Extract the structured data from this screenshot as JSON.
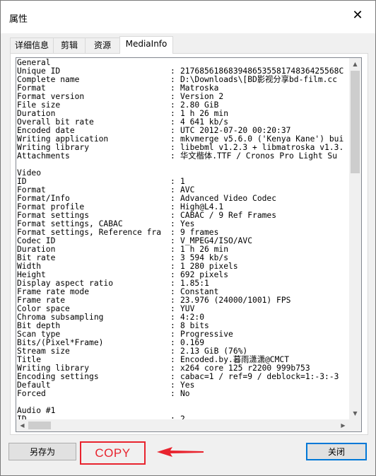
{
  "window": {
    "title": "属性",
    "close_glyph": "✕"
  },
  "tabs": [
    {
      "label": "详细信息",
      "active": false
    },
    {
      "label": "剪辑",
      "active": false
    },
    {
      "label": "资源",
      "active": false
    },
    {
      "label": "MediaInfo",
      "active": true
    }
  ],
  "mediainfo": {
    "lines": [
      {
        "label": "General",
        "value": ""
      },
      {
        "label": "Unique ID",
        "value": "217685618683948653558174836425568C"
      },
      {
        "label": "Complete name",
        "value": "D:\\Downloads\\[BD影视分享bd-film.cc"
      },
      {
        "label": "Format",
        "value": "Matroska"
      },
      {
        "label": "Format version",
        "value": "Version 2"
      },
      {
        "label": "File size",
        "value": "2.80 GiB"
      },
      {
        "label": "Duration",
        "value": "1 h 26 min"
      },
      {
        "label": "Overall bit rate",
        "value": "4 641 kb/s"
      },
      {
        "label": "Encoded date",
        "value": "UTC 2012-07-20 00:20:37"
      },
      {
        "label": "Writing application",
        "value": "mkvmerge v5.6.0 ('Kenya Kane') bui"
      },
      {
        "label": "Writing library",
        "value": "libebml v1.2.3 + libmatroska v1.3."
      },
      {
        "label": "Attachments",
        "value": "华文楷体.TTF / Cronos Pro Light Su"
      },
      {
        "label": "",
        "value": ""
      },
      {
        "label": "Video",
        "value": ""
      },
      {
        "label": "ID",
        "value": "1"
      },
      {
        "label": "Format",
        "value": "AVC"
      },
      {
        "label": "Format/Info",
        "value": "Advanced Video Codec"
      },
      {
        "label": "Format profile",
        "value": "High@L4.1"
      },
      {
        "label": "Format settings",
        "value": "CABAC / 9 Ref Frames"
      },
      {
        "label": "Format settings, CABAC",
        "value": "Yes"
      },
      {
        "label": "Format settings, Reference fra",
        "value": "9 frames"
      },
      {
        "label": "Codec ID",
        "value": "V_MPEG4/ISO/AVC"
      },
      {
        "label": "Duration",
        "value": "1 h 26 min"
      },
      {
        "label": "Bit rate",
        "value": "3 594 kb/s"
      },
      {
        "label": "Width",
        "value": "1 280 pixels"
      },
      {
        "label": "Height",
        "value": "692 pixels"
      },
      {
        "label": "Display aspect ratio",
        "value": "1.85:1"
      },
      {
        "label": "Frame rate mode",
        "value": "Constant"
      },
      {
        "label": "Frame rate",
        "value": "23.976 (24000/1001) FPS"
      },
      {
        "label": "Color space",
        "value": "YUV"
      },
      {
        "label": "Chroma subsampling",
        "value": "4:2:0"
      },
      {
        "label": "Bit depth",
        "value": "8 bits"
      },
      {
        "label": "Scan type",
        "value": "Progressive"
      },
      {
        "label": "Bits/(Pixel*Frame)",
        "value": "0.169"
      },
      {
        "label": "Stream size",
        "value": "2.13 GiB (76%)"
      },
      {
        "label": "Title",
        "value": "Encoded.by.暮雨潇潇@CMCT"
      },
      {
        "label": "Writing library",
        "value": "x264 core 125 r2200 999b753"
      },
      {
        "label": "Encoding settings",
        "value": "cabac=1 / ref=9 / deblock=1:-3:-3"
      },
      {
        "label": "Default",
        "value": "Yes"
      },
      {
        "label": "Forced",
        "value": "No"
      },
      {
        "label": "",
        "value": ""
      },
      {
        "label": "Audio #1",
        "value": ""
      },
      {
        "label": "ID",
        "value": "2"
      }
    ]
  },
  "buttons": {
    "save_as": "另存为",
    "close": "关闭"
  },
  "annotation": {
    "text": "COPY",
    "color": "#e8232e"
  },
  "colors": {
    "accent": "#0078d7",
    "annotation_red": "#e8232e"
  },
  "icons": {
    "close": "close-icon",
    "arrow": "red-arrow-icon"
  }
}
